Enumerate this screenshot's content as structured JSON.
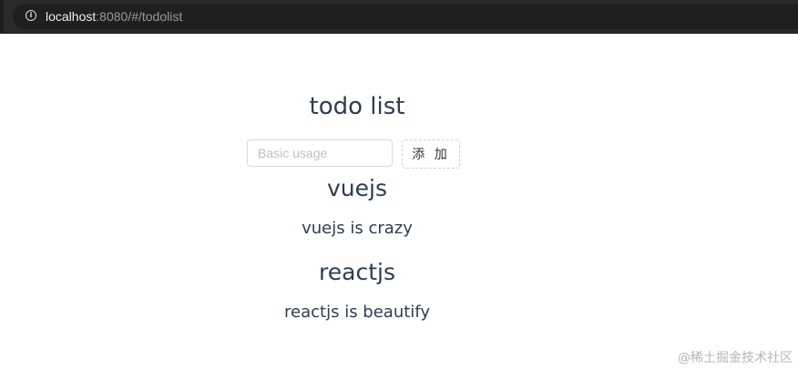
{
  "browser": {
    "url_host": "localhost",
    "url_rest": ":8080/#/todolist"
  },
  "app": {
    "title": "todo list",
    "input": {
      "placeholder": "Basic usage",
      "value": ""
    },
    "add_button_label": "添 加",
    "todos": [
      {
        "title": "vuejs",
        "description": "vuejs is crazy"
      },
      {
        "title": "reactjs",
        "description": "reactjs is beautify"
      }
    ]
  },
  "watermark": "@稀土掘金技术社区"
}
